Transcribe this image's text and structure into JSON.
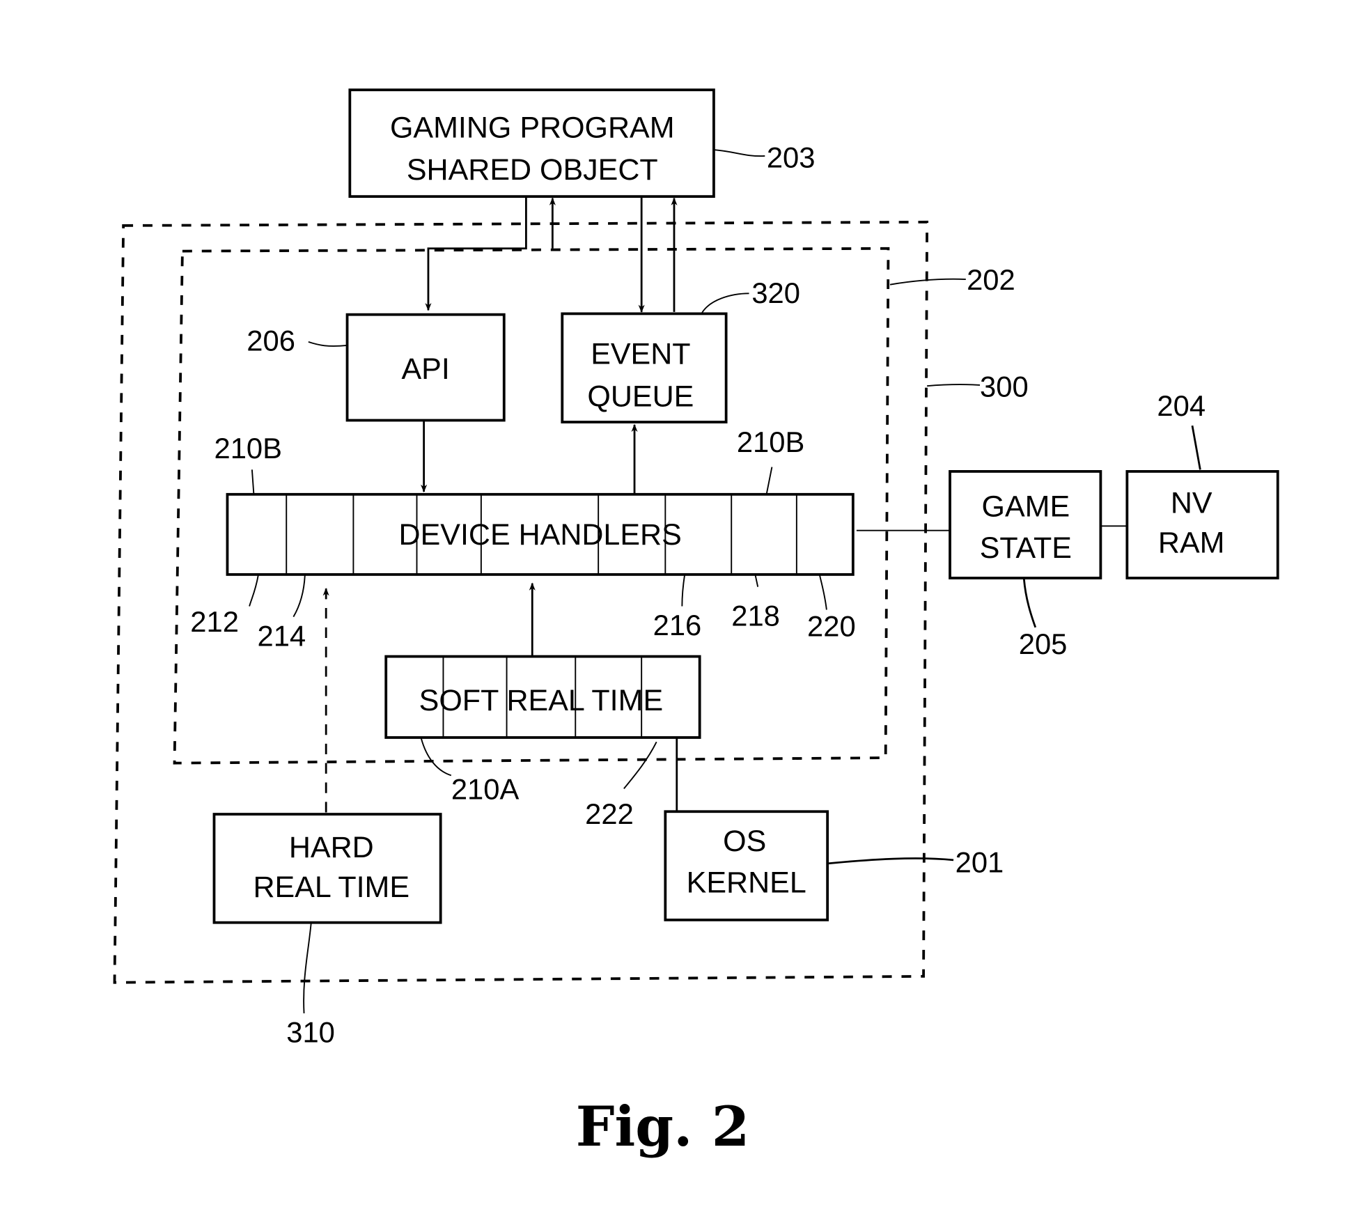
{
  "figure": {
    "caption": "Fig. 2",
    "blocks": {
      "gaming_program": {
        "line1": "GAMING PROGRAM",
        "line2": "SHARED OBJECT",
        "ref": "203"
      },
      "api": {
        "label": "API",
        "ref": "206"
      },
      "event_queue": {
        "line1": "EVENT",
        "line2": "QUEUE",
        "ref": "320"
      },
      "device_handlers": {
        "label": "DEVICE HANDLERS",
        "ref_left": "210B",
        "ref_right": "210B",
        "cell_refs": [
          "212",
          "214",
          "216",
          "218",
          "220"
        ]
      },
      "soft_real_time": {
        "label": "SOFT REAL TIME",
        "ref_a": "210A",
        "ref_b": "222"
      },
      "hard_real_time": {
        "line1": "HARD",
        "line2": "REAL TIME",
        "ref": "310"
      },
      "os_kernel": {
        "line1": "OS",
        "line2": "KERNEL",
        "ref": "201"
      },
      "game_state": {
        "line1": "GAME",
        "line2": "STATE",
        "ref": "205"
      },
      "nv_ram": {
        "line1": "NV",
        "line2": "RAM",
        "ref": "204"
      }
    },
    "regions": {
      "inner": {
        "ref": "202"
      },
      "outer": {
        "ref": "300"
      }
    }
  }
}
